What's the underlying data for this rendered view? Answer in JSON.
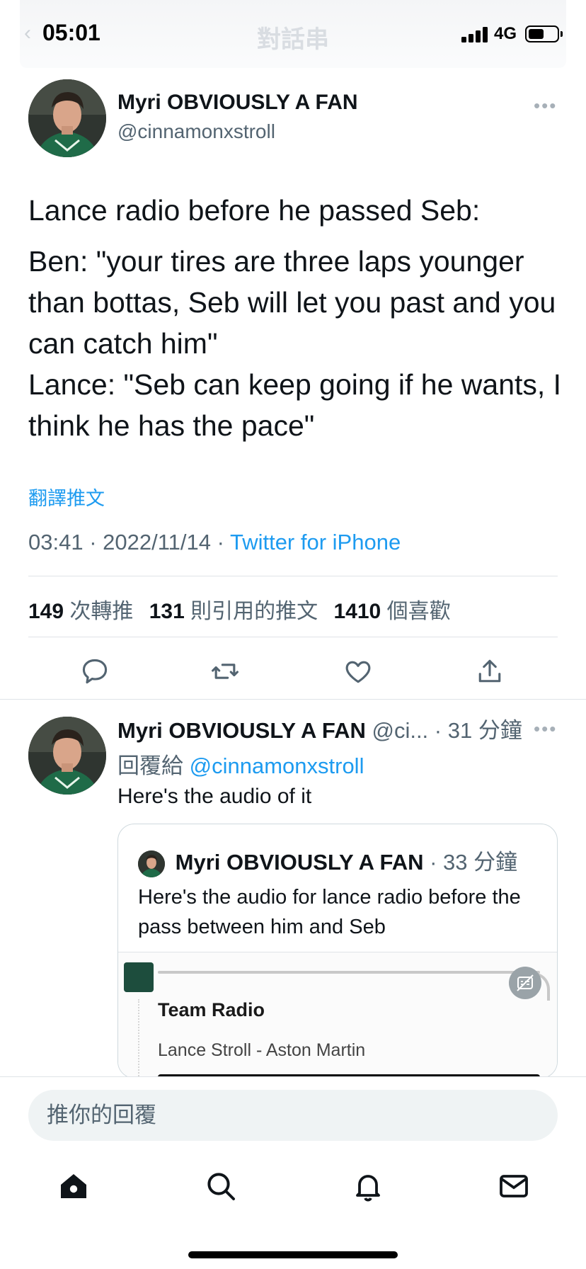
{
  "status_bar": {
    "time": "05:01",
    "network": "4G",
    "header_title": "對話串",
    "battery_level": 0.55
  },
  "tweet": {
    "author_name": "Myri OBVIOUSLY A FAN",
    "author_handle": "@cinnamonxstroll",
    "text_line1": "Lance radio before he passed Seb:",
    "text_body": "Ben: \"your tires are three laps younger than bottas, Seb will let you past and you can catch him\"\nLance: \"Seb can keep going if he wants, I think he has the pace\"",
    "translate_label": "翻譯推文",
    "timestamp": "03:41 · 2022/11/14 · ",
    "source": "Twitter for iPhone",
    "retweets_count": "149",
    "retweets_label": "次轉推",
    "quotes_count": "131",
    "quotes_label": "則引用的推文",
    "likes_count": "1410",
    "likes_label": "個喜歡",
    "more_icon": "more-horizontal-icon"
  },
  "reply": {
    "author_name": "Myri OBVIOUSLY A FAN",
    "author_handle_short": "@ci...",
    "time_ago": "· 31 分鐘",
    "replying_label": "回覆給",
    "replying_to": "@cinnamonxstroll",
    "text": "Here's the audio of it",
    "quote": {
      "author_name": "Myri OBVIOUSLY A FAN",
      "time_ago": "· 33 分鐘",
      "text": "Here's the audio for lance radio before the pass between him and Seb",
      "media_title": "Team Radio",
      "media_subtitle": "Lance Stroll - Aston Martin"
    }
  },
  "composer": {
    "placeholder": "推你的回覆"
  },
  "tab_bar": [
    "home-icon",
    "search-icon",
    "notifications-icon",
    "messages-icon"
  ],
  "colors": {
    "accent": "#1d9bf0",
    "secondary_text": "#536471",
    "primary_text": "#0f1419",
    "divider": "#dfe3e7"
  }
}
